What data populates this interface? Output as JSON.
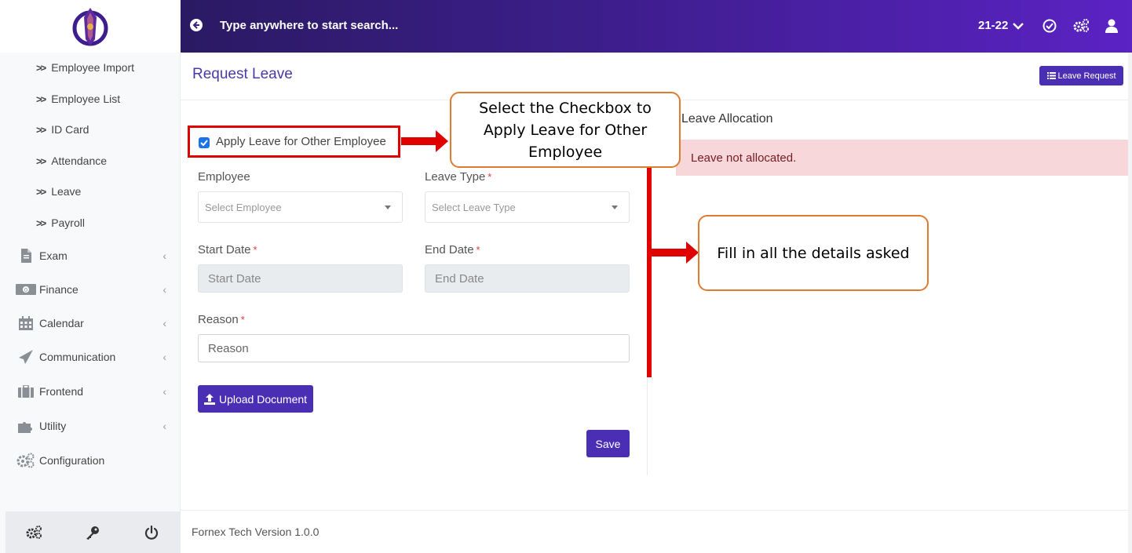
{
  "sidebar": {
    "sub_items": [
      {
        "label": "Employee Import"
      },
      {
        "label": "Employee List"
      },
      {
        "label": "ID Card"
      },
      {
        "label": "Attendance"
      },
      {
        "label": "Leave"
      },
      {
        "label": "Payroll"
      }
    ],
    "main_items": [
      {
        "label": "Exam",
        "icon": "file-icon"
      },
      {
        "label": "Finance",
        "icon": "money-icon"
      },
      {
        "label": "Calendar",
        "icon": "calendar-icon"
      },
      {
        "label": "Communication",
        "icon": "paper-plane-icon"
      },
      {
        "label": "Frontend",
        "icon": "briefcase-icon"
      },
      {
        "label": "Utility",
        "icon": "puzzle-icon"
      },
      {
        "label": "Configuration",
        "icon": "cogs-icon"
      }
    ],
    "footer_icons": [
      "cogs-icon",
      "key-icon",
      "power-icon"
    ]
  },
  "topbar": {
    "search_placeholder": "Type anywhere to start search...",
    "session": "21-22"
  },
  "page": {
    "title": "Request Leave",
    "leave_request_button": "Leave Request"
  },
  "form": {
    "apply_other_label": "Apply Leave for Other Employee",
    "apply_other_checked": true,
    "employee_label": "Employee",
    "employee_placeholder": "Select Employee",
    "leave_type_label": "Leave Type",
    "leave_type_placeholder": "Select Leave Type",
    "start_date_label": "Start Date",
    "start_date_placeholder": "Start Date",
    "end_date_label": "End Date",
    "end_date_placeholder": "End Date",
    "reason_label": "Reason",
    "reason_placeholder": "Reason",
    "required_mark": "*",
    "upload_button": "Upload Document",
    "save_button": "Save"
  },
  "allocation": {
    "title": "Leave Allocation",
    "message": "Leave not allocated."
  },
  "annotations": {
    "checkbox_callout": "Select the Checkbox to Apply Leave for Other Employee",
    "details_callout": "Fill in all the details asked"
  },
  "footer": {
    "version": "Fornex Tech Version 1.0.0"
  },
  "colors": {
    "primary": "#4a2fb5",
    "topbar_start": "#2a1a63",
    "topbar_end": "#5b22c4",
    "alert_bg": "#f8d7da",
    "annotation_red": "#e00000",
    "callout_border": "#e07a2e"
  }
}
